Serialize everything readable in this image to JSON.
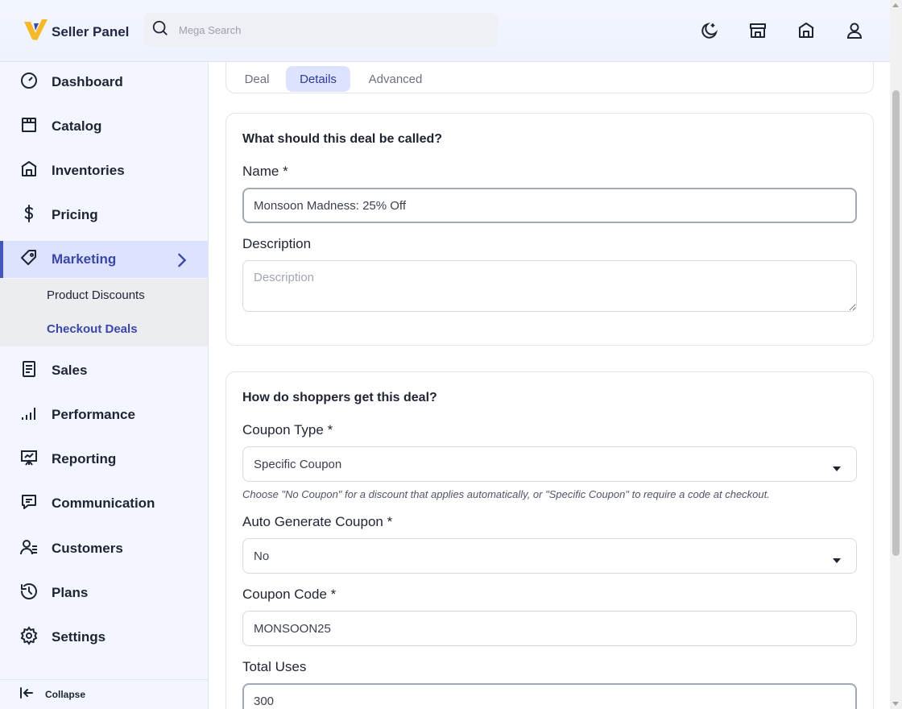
{
  "brand": {
    "name": "Seller Panel",
    "logo_icon": "v-logo-icon",
    "logo_colors": [
      "#f5b829",
      "#3b4aa8"
    ]
  },
  "search": {
    "placeholder": "Mega Search",
    "icon": "search-icon"
  },
  "header_icons": [
    "moon-icon",
    "store-icon",
    "warehouse-icon",
    "user-icon"
  ],
  "sidebar": {
    "items": [
      {
        "label": "Dashboard",
        "icon": "gauge-icon"
      },
      {
        "label": "Catalog",
        "icon": "box-icon"
      },
      {
        "label": "Inventories",
        "icon": "warehouse-icon"
      },
      {
        "label": "Pricing",
        "icon": "dollar-icon"
      },
      {
        "label": "Marketing",
        "icon": "tag-icon",
        "active": true,
        "expanded": true
      },
      {
        "label": "Sales",
        "icon": "receipt-icon"
      },
      {
        "label": "Performance",
        "icon": "bars-icon"
      },
      {
        "label": "Reporting",
        "icon": "presentation-icon"
      },
      {
        "label": "Communication",
        "icon": "chat-icon"
      },
      {
        "label": "Customers",
        "icon": "users-icon"
      },
      {
        "label": "Plans",
        "icon": "history-icon"
      },
      {
        "label": "Settings",
        "icon": "gear-icon"
      }
    ],
    "marketing_sub": [
      {
        "label": "Product Discounts",
        "active": false
      },
      {
        "label": "Checkout Deals",
        "active": true
      }
    ],
    "collapse_label": "Collapse"
  },
  "tabs": [
    {
      "label": "Deal",
      "active": false
    },
    {
      "label": "Details",
      "active": true
    },
    {
      "label": "Advanced",
      "active": false
    }
  ],
  "section_name": {
    "title": "What should this deal be called?",
    "name_label": "Name",
    "name_value": "Monsoon Madness: 25% Off",
    "description_label": "Description",
    "description_placeholder": "Description",
    "required_mark": "*"
  },
  "section_coupon": {
    "title": "How do shoppers get this deal?",
    "coupon_type_label": "Coupon Type",
    "coupon_type_value": "Specific Coupon",
    "coupon_type_hint": "Choose \"No Coupon\" for a discount that applies automatically, or \"Specific Coupon\" to require a code at checkout.",
    "auto_generate_label": "Auto Generate Coupon",
    "auto_generate_value": "No",
    "coupon_code_label": "Coupon Code",
    "coupon_code_value": "MONSOON25",
    "total_uses_label": "Total Uses",
    "total_uses_value": "300",
    "required_mark": "*"
  },
  "colors": {
    "accent": "#3a47a8",
    "active_bg": "#dde3ff",
    "sidebar_bg": "#f3f6ff"
  }
}
